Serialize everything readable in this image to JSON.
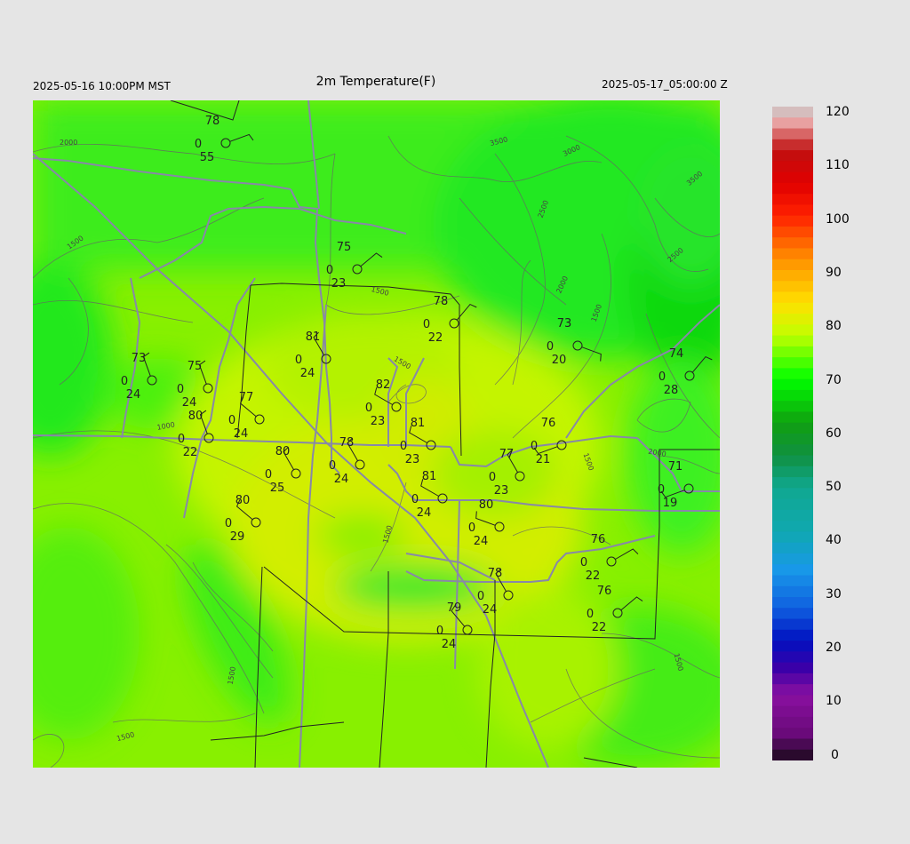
{
  "header": {
    "local_time": "2025-05-16 10:00PM MST",
    "title": "2m Temperature(F)",
    "valid_time": "2025-05-17_05:00:00 Z"
  },
  "colorbar": {
    "ticks": [
      "120",
      "110",
      "100",
      "90",
      "80",
      "70",
      "60",
      "50",
      "40",
      "30",
      "20",
      "10",
      "0"
    ],
    "stops": [
      {
        "v": 0,
        "c": "#1a0a1a"
      },
      {
        "v": 5,
        "c": "#6a0a7a"
      },
      {
        "v": 12,
        "c": "#8a10a0"
      },
      {
        "v": 17,
        "c": "#3a00a8"
      },
      {
        "v": 22,
        "c": "#0010c0"
      },
      {
        "v": 28,
        "c": "#1060e0"
      },
      {
        "v": 35,
        "c": "#1898e8"
      },
      {
        "v": 42,
        "c": "#10a8b0"
      },
      {
        "v": 50,
        "c": "#10a890"
      },
      {
        "v": 56,
        "c": "#109040"
      },
      {
        "v": 62,
        "c": "#10a010"
      },
      {
        "v": 70,
        "c": "#00ff00"
      },
      {
        "v": 78,
        "c": "#c0ff00"
      },
      {
        "v": 84,
        "c": "#ffe000"
      },
      {
        "v": 92,
        "c": "#ff9000"
      },
      {
        "v": 100,
        "c": "#ff2000"
      },
      {
        "v": 106,
        "c": "#e00000"
      },
      {
        "v": 112,
        "c": "#c01010"
      },
      {
        "v": 117,
        "c": "#e8a0a0"
      },
      {
        "v": 120,
        "c": "#cccccc"
      }
    ]
  },
  "contours": [
    "2000",
    "1500",
    "1000",
    "3500",
    "3000",
    "3500",
    "2500",
    "2000",
    "2500",
    "1500",
    "1500",
    "1500",
    "2000",
    "1500",
    "1500",
    "1500",
    "1500",
    "1500"
  ],
  "stations": [
    {
      "t": "78",
      "d": "0",
      "dp": "55"
    },
    {
      "t": "75",
      "d": "0",
      "dp": "23"
    },
    {
      "t": "78",
      "d": "0",
      "dp": "22"
    },
    {
      "t": "73",
      "d": "0",
      "dp": "20"
    },
    {
      "t": "74",
      "d": "0",
      "dp": "28"
    },
    {
      "t": "81",
      "d": "0",
      "dp": "24"
    },
    {
      "t": "73",
      "d": "0",
      "dp": "24"
    },
    {
      "t": "75",
      "d": "0",
      "dp": "24"
    },
    {
      "t": "82",
      "d": "0",
      "dp": "23"
    },
    {
      "t": "77",
      "d": "0",
      "dp": "24"
    },
    {
      "t": "80",
      "d": "0",
      "dp": "22"
    },
    {
      "t": "81",
      "d": "0",
      "dp": "23"
    },
    {
      "t": "76",
      "d": "0",
      "dp": "21"
    },
    {
      "t": "78",
      "d": "0",
      "dp": "24"
    },
    {
      "t": "80",
      "d": "0",
      "dp": "25"
    },
    {
      "t": "77",
      "d": "0",
      "dp": "23"
    },
    {
      "t": "71",
      "d": "0",
      "dp": "19"
    },
    {
      "t": "81",
      "d": "0",
      "dp": "24"
    },
    {
      "t": "80",
      "d": "0",
      "dp": "29"
    },
    {
      "t": "80",
      "d": "0",
      "dp": "24"
    },
    {
      "t": "76",
      "d": "0",
      "dp": "22"
    },
    {
      "t": "78",
      "d": "0",
      "dp": "24"
    },
    {
      "t": "76",
      "d": "0",
      "dp": "22"
    },
    {
      "t": "79",
      "d": "0",
      "dp": "24"
    }
  ]
}
